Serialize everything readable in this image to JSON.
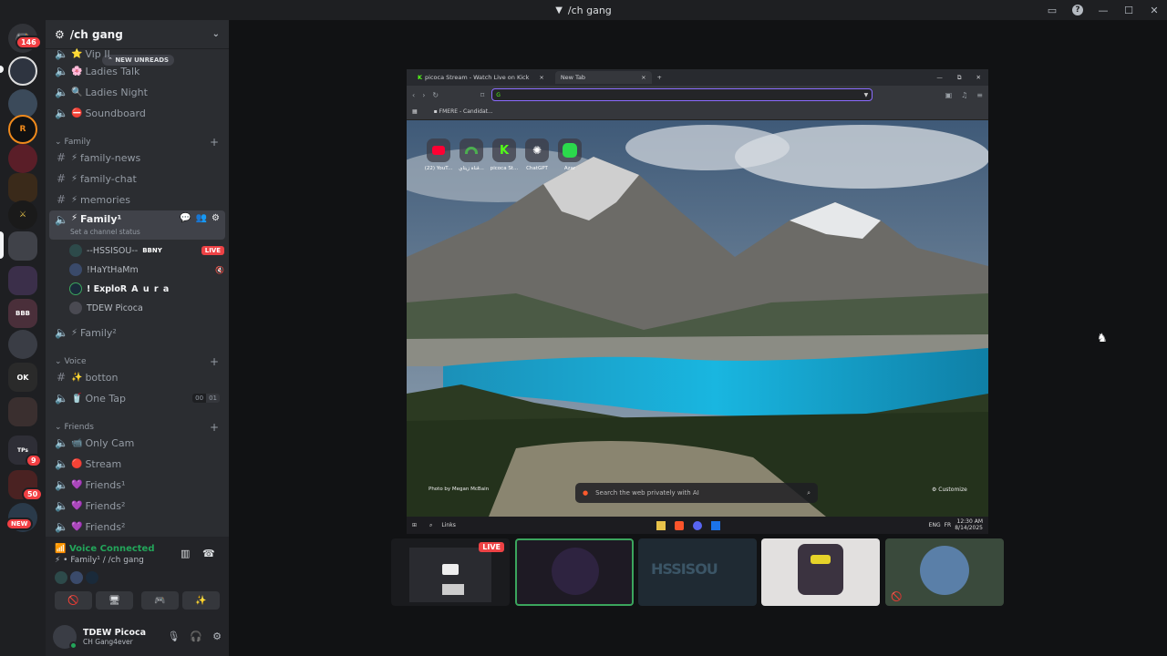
{
  "titlebar": {
    "title": "/ch gang"
  },
  "rail": {
    "mentions_badge": "146",
    "new_badge": "NEW",
    "badge_9": "9",
    "badge_50": "50",
    "guild_labels": {
      "tps": "TPs",
      "ps": "ps",
      "ok": "OK",
      "bbb": "BBB"
    }
  },
  "server": {
    "name": "/ch gang",
    "new_unreads": "NEW UNREADS"
  },
  "channels_top": [
    {
      "name": "Vip II",
      "emoji": "⭐"
    },
    {
      "name": "Ladies Talk",
      "emoji": "🌸"
    },
    {
      "name": "Ladies Night",
      "emoji": "🔍"
    },
    {
      "name": "Soundboard",
      "emoji": "⛔"
    }
  ],
  "cat_family": {
    "name": "Family",
    "channels": [
      {
        "name": "family-news",
        "emoji": "⚡"
      },
      {
        "name": "family-chat",
        "emoji": "⚡"
      },
      {
        "name": "memories",
        "emoji": "⚡"
      }
    ]
  },
  "active_voice": {
    "name": "Family¹",
    "emoji": "⚡",
    "status": "Set a channel status",
    "users": [
      {
        "name": "--HSSISOU--",
        "tag": "BBNY",
        "live": "LIVE"
      },
      {
        "name": "!HaYtHaMm",
        "tag": "",
        "live": ""
      },
      {
        "name": "! ExploR",
        "tag": "A u r a",
        "live": ""
      },
      {
        "name": "TDEW Picoca",
        "tag": "",
        "live": ""
      }
    ]
  },
  "family2": {
    "name": "Family²",
    "emoji": "⚡"
  },
  "cat_voice": {
    "name": "Voice",
    "channels": [
      {
        "name": "botton",
        "emoji": "✨"
      },
      {
        "name": "One Tap",
        "emoji": "🥤",
        "count_a": "00",
        "count_b": "01"
      }
    ]
  },
  "cat_friends": {
    "name": "Friends",
    "channels": [
      {
        "name": "Only Cam",
        "emoji": "📹"
      },
      {
        "name": "Stream",
        "emoji": "🔴"
      },
      {
        "name": "Friends¹",
        "emoji": "💜"
      },
      {
        "name": "Friends²",
        "emoji": "💜"
      },
      {
        "name": "Friends²",
        "emoji": "💜"
      }
    ]
  },
  "voice_connected": {
    "title": "Voice Connected",
    "channel": "⚡ • Family¹ / /ch gang"
  },
  "user": {
    "name": "TDEW Picoca",
    "status": "CH Gang4ever"
  },
  "stream": {
    "tab1": "picoca Stream - Watch Live on Kick",
    "tab2": "New Tab",
    "url": "G",
    "bookmark": "FMERE - Candidat...",
    "tiles": [
      {
        "label": "(22) YouT...",
        "color": "#ff0033"
      },
      {
        "label": "قناة زيتاي...",
        "color": "#4caf50"
      },
      {
        "label": "picoca St...",
        "color": "#53fc18"
      },
      {
        "label": "ChatGPT",
        "color": "#ffffff"
      },
      {
        "label": "Azar",
        "color": "#2bd94c"
      }
    ],
    "photo_credit": "Photo by Megan McBain",
    "search_placeholder": "Search the web privately with AI",
    "customize": "Customize",
    "taskbar_links": "Links",
    "lang": "ENG",
    "lang2": "FR",
    "clock": "12:30 AM",
    "date": "8/14/2025"
  },
  "thumbs": {
    "live": "LIVE",
    "hss_text": "HSSISOU"
  }
}
